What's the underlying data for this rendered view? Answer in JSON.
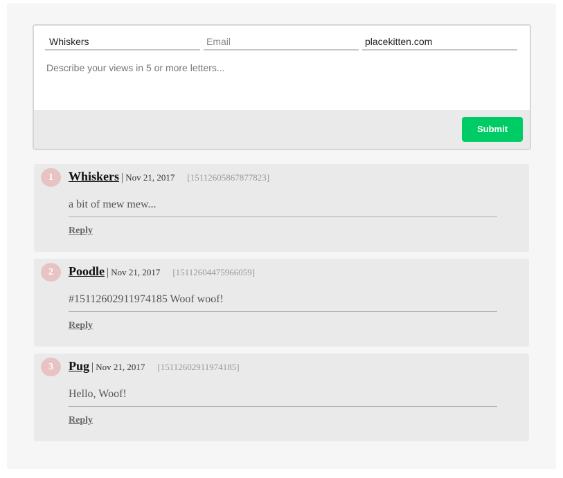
{
  "form": {
    "name_value": "Whiskers",
    "email_placeholder": "Email",
    "website_value": "placekitten.com",
    "message_placeholder": "Describe your views in 5 or more letters...",
    "submit_label": "Submit"
  },
  "comments": [
    {
      "number": "1",
      "author": "Whiskers",
      "separator": "|",
      "date": "Nov 21, 2017",
      "id": "[15112605867877823]",
      "text": "a bit of mew mew...",
      "reply_label": "Reply"
    },
    {
      "number": "2",
      "author": "Poodle",
      "separator": "|",
      "date": "Nov 21, 2017",
      "id": "[15112604475966059]",
      "text": "#15112602911974185 Woof woof!",
      "reply_label": "Reply"
    },
    {
      "number": "3",
      "author": "Pug",
      "separator": "|",
      "date": "Nov 21, 2017",
      "id": "[15112602911974185]",
      "text": "Hello, Woof!",
      "reply_label": "Reply"
    }
  ],
  "colors": {
    "accent": "#00cc66",
    "badge": "#e7c3c3",
    "card_bg": "#eaeaea",
    "page_bg": "#f6f6f6"
  }
}
